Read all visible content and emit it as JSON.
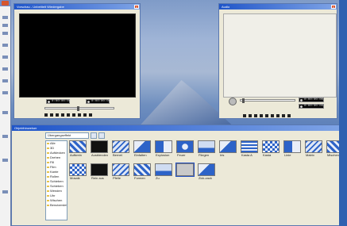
{
  "left_window": {
    "items": [
      1,
      2,
      3,
      4,
      5,
      6,
      7,
      8,
      9,
      10,
      11,
      12
    ]
  },
  "preview_window": {
    "title": "Vorschau - Unbetitelt Wiedergabe",
    "close": "x",
    "timecode_left": "0:00:00:00",
    "timecode_right": "0:00:00:00",
    "controls": [
      "▶",
      "◼",
      "▲",
      "◀◀",
      "▶▶",
      "◀",
      "▶",
      "[",
      "]"
    ]
  },
  "audio_window": {
    "title": "Audio",
    "close": "x",
    "timecode_top": "0:00:00:00",
    "timecode_bottom": "0:00:00:00",
    "controls": [
      "▶",
      "◼",
      "▲",
      "◀◀",
      "▶▶",
      "◀",
      "▶",
      "[",
      "]"
    ]
  },
  "effects_window": {
    "title": "Objekthinweiser",
    "close": "x",
    "category_combo": "Übergangseffekt",
    "tree_items": [
      "Alle",
      "3D",
      "Aufdecken",
      "Drehen",
      "Fill",
      "Film",
      "Kante",
      "Rollen",
      "Schieben",
      "Schieben",
      "Wenden",
      "Uhr",
      "Wischen",
      "Benutzerdef"
    ],
    "tiles_row1": [
      "Aufbrein",
      "Ausblenden",
      "Bernet",
      "Einfalten",
      "Explosion",
      "Feuer",
      "Fliegen",
      "Iris",
      "Kasta A",
      "Kasta",
      "Linie",
      "Matrix",
      "Mischen"
    ],
    "tiles_row2": [
      "Mosaik",
      "Rein aus",
      "Pfeile",
      "Formen",
      "Zu",
      "",
      "Zick-zack"
    ]
  },
  "colors": {
    "titlebar_start": "#1f55c9",
    "titlebar_end": "#7fa4e6",
    "window_bg": "#ece9d8",
    "tile_blue": "#2d63c8",
    "close_red": "#d44a25"
  }
}
